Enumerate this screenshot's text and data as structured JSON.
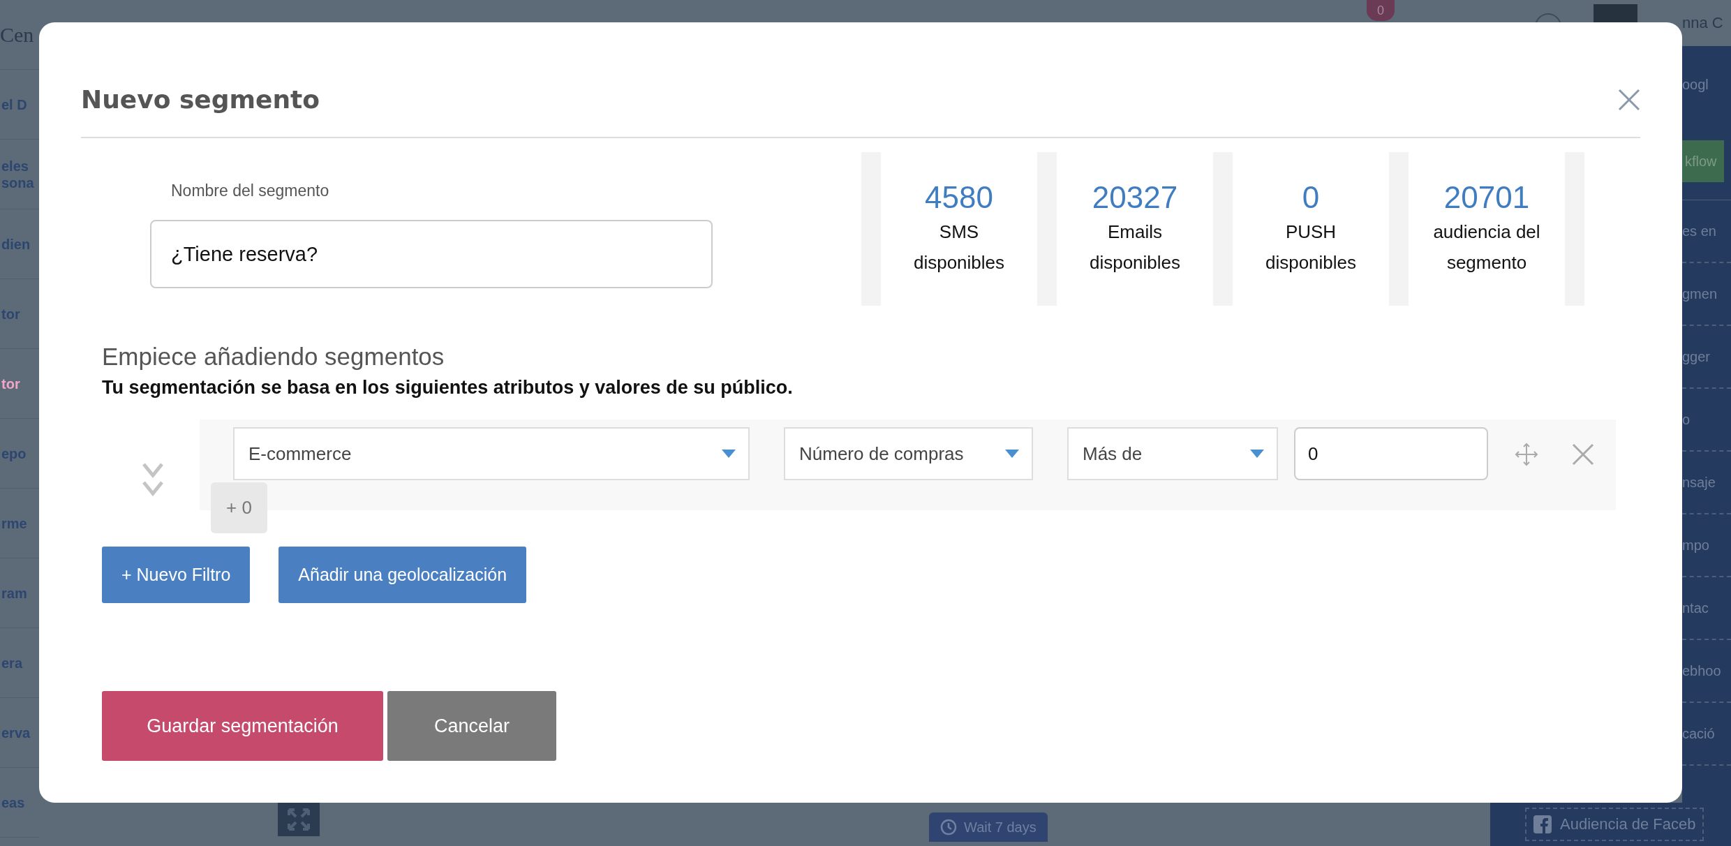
{
  "background": {
    "logo_text": "Cen",
    "notification_count": "0",
    "user_name": "nna C",
    "sidebar_items": [
      {
        "lines": [
          "el D"
        ],
        "selected": false
      },
      {
        "lines": [
          "eles",
          "sona"
        ],
        "selected": false
      },
      {
        "lines": [
          "dien"
        ],
        "selected": false
      },
      {
        "lines": [
          "tor"
        ],
        "selected": false
      },
      {
        "lines": [
          "tor"
        ],
        "selected": true
      },
      {
        "lines": [
          "epo"
        ],
        "selected": false
      },
      {
        "lines": [
          "rme"
        ],
        "selected": false
      },
      {
        "lines": [
          "ram"
        ],
        "selected": false
      },
      {
        "lines": [
          "era"
        ],
        "selected": false
      },
      {
        "lines": [
          "erva"
        ],
        "selected": false
      },
      {
        "lines": [
          "eas"
        ],
        "selected": false
      }
    ],
    "panel_items": [
      {
        "label": "oogl",
        "kind": "header"
      },
      {
        "label": "kflow",
        "kind": "button"
      },
      {
        "label": "es en",
        "kind": "item"
      },
      {
        "label": "gmen",
        "kind": "item"
      },
      {
        "label": "gger",
        "kind": "item"
      },
      {
        "label": "o",
        "kind": "item"
      },
      {
        "label": "nsaje",
        "kind": "item"
      },
      {
        "label": "mpo",
        "kind": "item"
      },
      {
        "label": "ntac",
        "kind": "item"
      },
      {
        "label": "ebhoo",
        "kind": "item"
      },
      {
        "label": "cació",
        "kind": "item"
      }
    ],
    "wait_step": "Wait 7 days",
    "audience_item": "Audiencia de Faceb"
  },
  "modal": {
    "title": "Nuevo segmento",
    "name_field": {
      "label": "Nombre del segmento",
      "value": "¿Tiene reserva?"
    },
    "stats": [
      {
        "value": "4580",
        "label": "SMS disponibles"
      },
      {
        "value": "20327",
        "label": "Emails disponibles"
      },
      {
        "value": "0",
        "label": "PUSH disponibles"
      },
      {
        "value": "20701",
        "label": "audiencia del segmento"
      }
    ],
    "section_title": "Empiece añadiendo segmentos",
    "section_subtitle": "Tu segmentación se basa en los siguientes atributos y valores de su público.",
    "filters": [
      {
        "category": "E-commerce",
        "attribute": "Número de compras",
        "operator": "Más de",
        "value": "0",
        "count": "+ 0"
      }
    ],
    "add_buttons": [
      "+ Nuevo Filtro",
      "Añadir una geolocalización"
    ],
    "actions": [
      {
        "label": "Guardar segmentación",
        "kind": "primary"
      },
      {
        "label": "Cancelar",
        "kind": "secondary"
      }
    ]
  }
}
